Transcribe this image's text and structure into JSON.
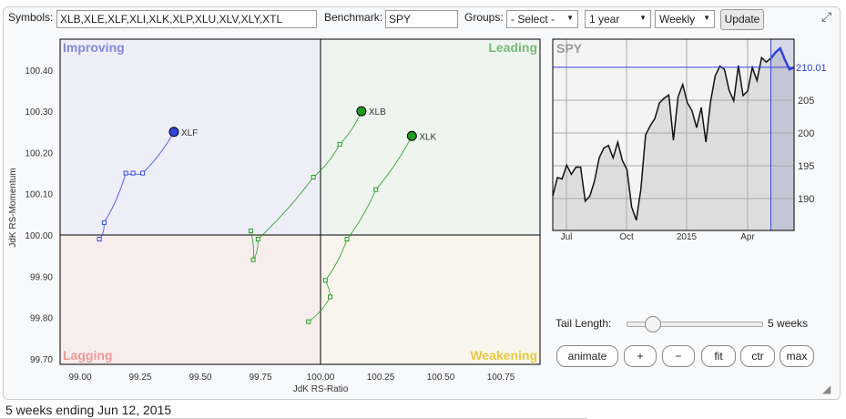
{
  "toolbar": {
    "symbols_label": "Symbols:",
    "symbols_value": "XLB,XLE,XLF,XLI,XLK,XLP,XLU,XLV,XLY,XTL",
    "benchmark_label": "Benchmark:",
    "benchmark_value": "SPY",
    "groups_label": "Groups:",
    "groups_value": "- Select -",
    "period_value": "1 year",
    "interval_value": "Weekly",
    "update_label": "Update"
  },
  "controls": {
    "tail_label": "Tail Length:",
    "tail_value": "5 weeks",
    "tail_fraction": 0.13,
    "animate": "animate",
    "plus": "+",
    "minus": "−",
    "fit": "fit",
    "ctr": "ctr",
    "max": "max"
  },
  "footer": "5 weeks ending Jun 12, 2015",
  "chart_data": [
    {
      "type": "scatter",
      "title": "Relative Rotation Graph",
      "xlabel": "JdK RS-Ratio",
      "ylabel": "JdK RS-Momentum",
      "xlim": [
        98.95,
        100.95
      ],
      "ylim": [
        99.685,
        100.425
      ],
      "xticks": [
        "99.00",
        "99.25",
        "99.50",
        "99.75",
        "100.00",
        "100.25",
        "100.50",
        "100.75"
      ],
      "yticks": [
        "100.40",
        "100.30",
        "100.20",
        "100.10",
        "100.00",
        "99.90",
        "99.80",
        "99.70"
      ],
      "quadrants": {
        "improving": "Improving",
        "leading": "Leading",
        "lagging": "Lagging",
        "weakening": "Weakening"
      },
      "series": [
        {
          "name": "XLF",
          "color": "#3344dd",
          "x": [
            99.08,
            99.1,
            99.19,
            99.22,
            99.26,
            99.39
          ],
          "y": [
            99.99,
            100.03,
            100.15,
            100.15,
            100.15,
            100.25
          ]
        },
        {
          "name": "XLB",
          "color": "#229922",
          "x": [
            99.71,
            99.72,
            99.74,
            99.97,
            100.08,
            100.17
          ],
          "y": [
            100.01,
            99.94,
            99.99,
            100.14,
            100.22,
            100.3
          ]
        },
        {
          "name": "XLK",
          "color": "#229922",
          "x": [
            99.95,
            100.04,
            100.02,
            100.11,
            100.23,
            100.38
          ],
          "y": [
            99.79,
            99.85,
            99.89,
            99.99,
            100.11,
            100.24
          ]
        }
      ]
    },
    {
      "type": "line",
      "title": "SPY",
      "last_label": "210.01",
      "last_value": 210.01,
      "ylim": [
        185.2,
        214
      ],
      "yticks": [
        "190",
        "195",
        "200",
        "205"
      ],
      "xticks": [
        "Jul",
        "Oct",
        "2015",
        "Apr"
      ],
      "values": [
        190.4,
        193.2,
        193,
        195.1,
        193.7,
        194.8,
        194.8,
        189.6,
        190.4,
        192.7,
        196.2,
        197.7,
        198.1,
        196.2,
        198.6,
        195.8,
        194.4,
        188.7,
        186.7,
        191.5,
        199.7,
        201.1,
        202.2,
        204.6,
        205.3,
        205.8,
        198.9,
        205.5,
        207.4,
        204.6,
        203.4,
        200.8,
        203.9,
        198.6,
        204.8,
        208.7,
        210.2,
        209.7,
        206.5,
        204.9,
        210.3,
        205.7,
        206.4,
        210.0,
        208.0,
        211.5,
        210.8,
        211.4,
        212.3,
        212.9,
        211.2,
        209.7,
        210.0
      ],
      "highlight_last_n": 5
    }
  ]
}
